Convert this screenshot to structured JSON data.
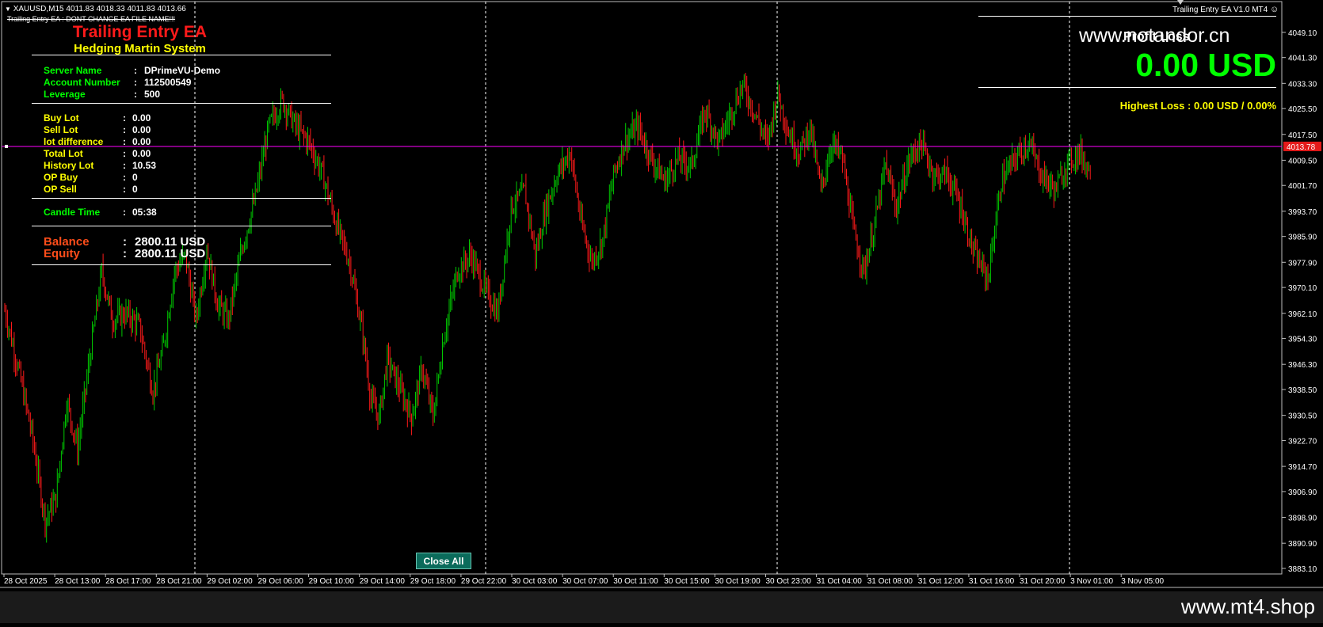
{
  "symbol_bar": {
    "text": "XAUUSD,M15  4011.83 4018.33 4011.83 4013.66"
  },
  "ea_note": "Trailing Entry EA : DONT CHANGE EA FILE NAME!!!",
  "ea_badge": "Trailing Entry EA  V1.0 MT4",
  "panel": {
    "title": "Trailing Entry EA",
    "subtitle": "Hedging Martin System",
    "colors": {
      "title": "#ff1a1a",
      "subtitle": "#ffff00",
      "account_labels": "#00ff00",
      "lot_labels": "#ffff00",
      "balance_labels": "#ff4d1a",
      "values": "#ffffff"
    },
    "account": [
      {
        "label": "Server Name",
        "value": "DPrimeVU-Demo"
      },
      {
        "label": "Account Number",
        "value": "112500549"
      },
      {
        "label": "Leverage",
        "value": "500"
      }
    ],
    "lots": [
      {
        "label": "Buy  Lot",
        "value": "0.00"
      },
      {
        "label": "Sell Lot",
        "value": "0.00"
      },
      {
        "label": "lot difference",
        "value": "0.00"
      },
      {
        "label": "Total Lot",
        "value": "0.00"
      },
      {
        "label": "History Lot",
        "value": "10.53"
      },
      {
        "label": "OP Buy",
        "value": "0"
      },
      {
        "label": "OP Sell",
        "value": "0"
      }
    ],
    "candle_time": {
      "label": "Candle Time",
      "value": "05:38"
    },
    "balance": {
      "label": "Balance",
      "value": "2800.11 USD"
    },
    "equity": {
      "label": "Equity",
      "value": "2800.11 USD"
    },
    "separator": ":"
  },
  "profit": {
    "header": "Profit Loss",
    "watermark": "www.notandor.cn",
    "value": "0.00 USD",
    "highest_loss": "Highest Loss  : 0.00 USD / 0.00%",
    "colors": {
      "value": "#00ff00",
      "highest_loss": "#ffff00"
    }
  },
  "close_all_button": "Close All",
  "current_price": "4013.78",
  "footer_watermark": "www.mt4.shop",
  "chart_data": {
    "type": "candlestick",
    "ylim": [
      3883.1,
      4052.5
    ],
    "price_ticks": [
      "4049.10",
      "4041.30",
      "4033.30",
      "4025.50",
      "4017.50",
      "4009.50",
      "4001.70",
      "3993.70",
      "3985.90",
      "3977.90",
      "3970.10",
      "3962.10",
      "3954.30",
      "3946.30",
      "3938.50",
      "3930.50",
      "3922.70",
      "3914.70",
      "3906.90",
      "3898.90",
      "3890.90",
      "3883.10"
    ],
    "time_labels": [
      "28 Oct 2025",
      "28 Oct 13:00",
      "28 Oct 17:00",
      "28 Oct 21:00",
      "29 Oct 02:00",
      "29 Oct 06:00",
      "29 Oct 10:00",
      "29 Oct 14:00",
      "29 Oct 18:00",
      "29 Oct 22:00",
      "30 Oct 03:00",
      "30 Oct 07:00",
      "30 Oct 11:00",
      "30 Oct 15:00",
      "30 Oct 19:00",
      "30 Oct 23:00",
      "31 Oct 04:00",
      "31 Oct 08:00",
      "31 Oct 12:00",
      "31 Oct 16:00",
      "31 Oct 20:00",
      "3 Nov 01:00",
      "3 Nov 05:00"
    ],
    "current_price": 4013.78,
    "up_color": "#00c800",
    "down_color": "#ff1a1a",
    "grid": false,
    "close_path": [
      [
        0,
        3963
      ],
      [
        10,
        3945
      ],
      [
        20,
        3925
      ],
      [
        30,
        3898
      ],
      [
        38,
        3905
      ],
      [
        46,
        3935
      ],
      [
        54,
        3920
      ],
      [
        62,
        3945
      ],
      [
        72,
        3975
      ],
      [
        80,
        3960
      ],
      [
        90,
        3962
      ],
      [
        100,
        3958
      ],
      [
        110,
        3938
      ],
      [
        118,
        3952
      ],
      [
        126,
        3975
      ],
      [
        134,
        3980
      ],
      [
        142,
        3960
      ],
      [
        150,
        3982
      ],
      [
        158,
        3965
      ],
      [
        166,
        3960
      ],
      [
        176,
        3982
      ],
      [
        186,
        3998
      ],
      [
        196,
        4020
      ],
      [
        206,
        4028
      ],
      [
        216,
        4020
      ],
      [
        226,
        4015
      ],
      [
        236,
        4005
      ],
      [
        246,
        3990
      ],
      [
        256,
        3978
      ],
      [
        266,
        3955
      ],
      [
        272,
        3935
      ],
      [
        278,
        3930
      ],
      [
        284,
        3948
      ],
      [
        292,
        3940
      ],
      [
        302,
        3930
      ],
      [
        310,
        3945
      ],
      [
        318,
        3930
      ],
      [
        326,
        3955
      ],
      [
        336,
        3975
      ],
      [
        346,
        3980
      ],
      [
        356,
        3970
      ],
      [
        366,
        3962
      ],
      [
        376,
        3995
      ],
      [
        386,
        4000
      ],
      [
        394,
        3980
      ],
      [
        402,
        3995
      ],
      [
        410,
        4005
      ],
      [
        420,
        4012
      ],
      [
        428,
        3990
      ],
      [
        436,
        3978
      ],
      [
        444,
        3985
      ],
      [
        452,
        4005
      ],
      [
        460,
        4015
      ],
      [
        470,
        4020
      ],
      [
        480,
        4010
      ],
      [
        490,
        4003
      ],
      [
        500,
        4010
      ],
      [
        510,
        4008
      ],
      [
        520,
        4025
      ],
      [
        530,
        4015
      ],
      [
        540,
        4025
      ],
      [
        548,
        4033
      ],
      [
        556,
        4025
      ],
      [
        566,
        4015
      ],
      [
        574,
        4030
      ],
      [
        582,
        4018
      ],
      [
        590,
        4012
      ],
      [
        598,
        4020
      ],
      [
        606,
        4000
      ],
      [
        614,
        4015
      ],
      [
        622,
        4010
      ],
      [
        630,
        3988
      ],
      [
        638,
        3975
      ],
      [
        646,
        3990
      ],
      [
        654,
        4008
      ],
      [
        662,
        3995
      ],
      [
        672,
        4010
      ],
      [
        680,
        4015
      ],
      [
        690,
        4005
      ],
      [
        700,
        4005
      ],
      [
        710,
        3995
      ],
      [
        720,
        3980
      ],
      [
        730,
        3973
      ],
      [
        740,
        4003
      ],
      [
        750,
        4010
      ],
      [
        760,
        4015
      ],
      [
        770,
        4005
      ],
      [
        780,
        4000
      ],
      [
        788,
        4008
      ],
      [
        798,
        4012
      ],
      [
        806,
        4006
      ]
    ]
  }
}
